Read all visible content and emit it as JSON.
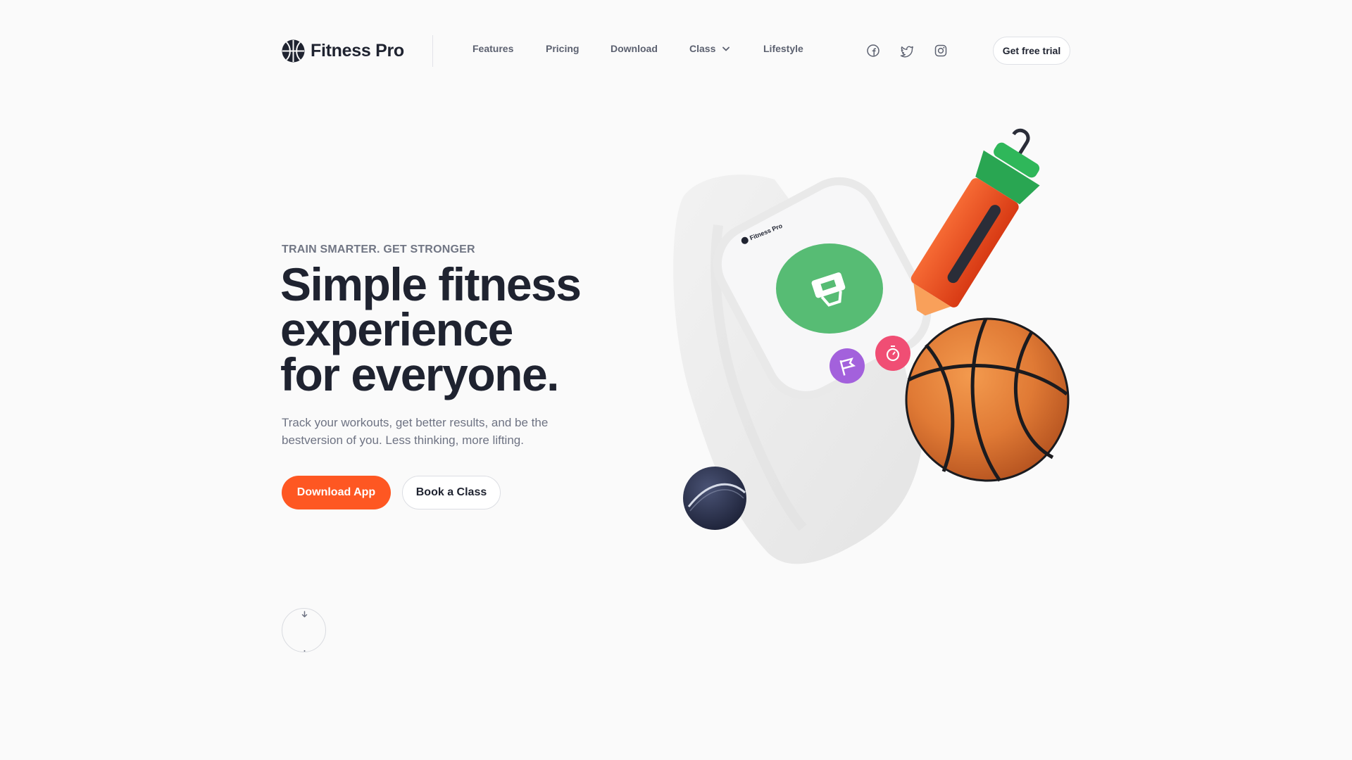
{
  "brand": {
    "name": "Fitness Pro",
    "logo_icon": "basketball-logo-icon"
  },
  "nav": {
    "items": [
      {
        "label": "Features"
      },
      {
        "label": "Pricing"
      },
      {
        "label": "Download"
      },
      {
        "label": "Class",
        "has_dropdown": true,
        "dropdown_icon": "chevron-down-icon"
      },
      {
        "label": "Lifestyle"
      }
    ]
  },
  "social": [
    "facebook-icon",
    "twitter-icon",
    "instagram-icon"
  ],
  "header_cta": {
    "label": "Get free trial"
  },
  "hero": {
    "eyebrow": "TRAIN SMARTER. GET STRONGER",
    "headline_lines": [
      "Simple fitness",
      "experience",
      "for everyone."
    ],
    "subtext": "Track your workouts, get better results, and be the bestversion of you. Less thinking, more lifting.",
    "primary_button": "Download App",
    "secondary_button": "Book a Class",
    "scroll_icon": "arrow-down-icon"
  },
  "illustration": {
    "watch_label": "Fitness Pro",
    "items": [
      "smartwatch",
      "shaker-bottle",
      "basketball",
      "tennis-ball"
    ]
  },
  "colors": {
    "accent": "#fe5722",
    "text_dark": "#1f2330",
    "text_muted": "#6e7383",
    "watch_green": "#57bc74",
    "watch_purple": "#a361dc",
    "watch_pink": "#f04e74",
    "bottle_orange": "#f04a1e",
    "bottle_green": "#2fb75a",
    "ball_orange": "#e07a35"
  }
}
